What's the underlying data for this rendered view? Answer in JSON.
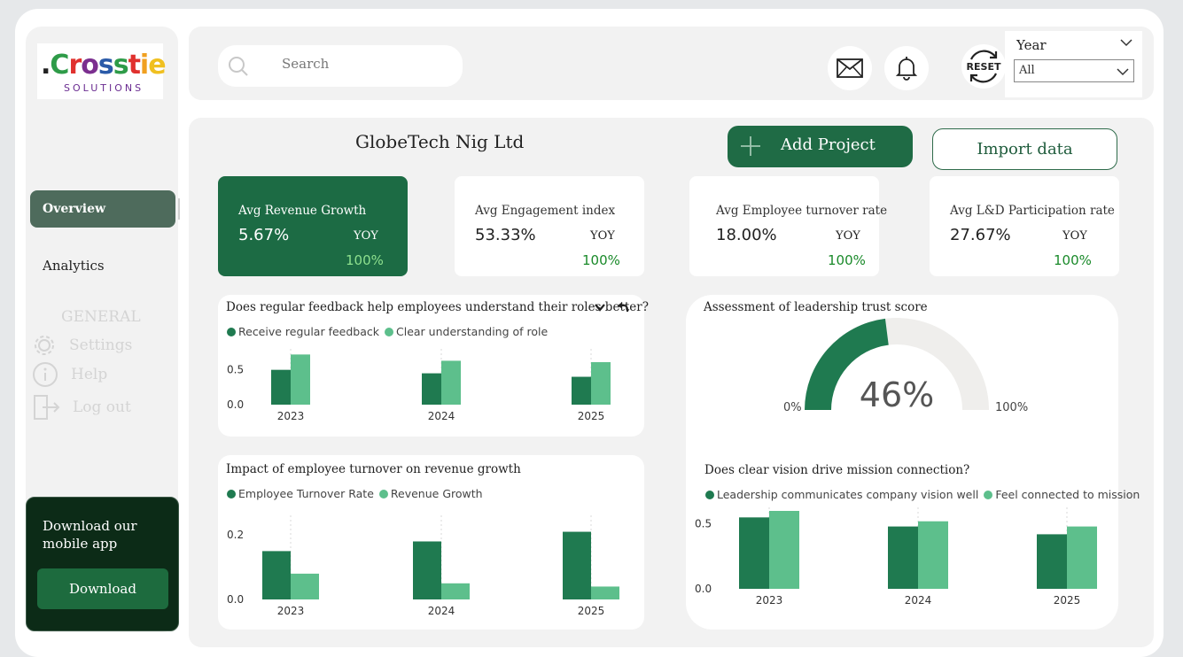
{
  "logo": {
    "brand": ".Crosstie",
    "sub": "SOLUTIONS"
  },
  "sidebar": {
    "overview": "Overview",
    "analytics": "Analytics",
    "general_title": "GENERAL",
    "items": [
      {
        "label": "Settings",
        "icon": "gear-icon"
      },
      {
        "label": "Help",
        "icon": "info-icon"
      },
      {
        "label": "Log out",
        "icon": "logout-icon"
      }
    ],
    "promo_text": "Download our mobile app",
    "promo_button": "Download"
  },
  "topbar": {
    "search_placeholder": "Search",
    "reset_label": "RESET",
    "year_label": "Year",
    "year_value": "All"
  },
  "main": {
    "company": "GlobeTech Nig Ltd",
    "add_project": "Add Project",
    "import_data": "Import data"
  },
  "kpis": [
    {
      "title": "Avg Revenue Growth",
      "value": "5.67%",
      "yoy": "YOY",
      "change": "100%"
    },
    {
      "title": "Avg Engagement index",
      "value": "53.33%",
      "yoy": "YOY",
      "change": "100%"
    },
    {
      "title": "Avg Employee turnover rate",
      "value": "18.00%",
      "yoy": "YOY",
      "change": "100%"
    },
    {
      "title": "Avg L&D Participation rate",
      "value": "27.67%",
      "yoy": "YOY",
      "change": "100%"
    }
  ],
  "colors": {
    "dark_green": "#1f7a50",
    "light_green": "#5dbf8c",
    "accent": "#1c6b44"
  },
  "chart_data": [
    {
      "type": "bar",
      "title": "Does regular feedback help employees understand their roles better?",
      "categories": [
        "2023",
        "2024",
        "2025"
      ],
      "series": [
        {
          "name": "Receive regular feedback",
          "values": [
            0.5,
            0.45,
            0.4
          ]
        },
        {
          "name": "Clear understanding of role",
          "values": [
            0.72,
            0.63,
            0.61
          ]
        }
      ],
      "yticks": [
        "0.0",
        "0.5"
      ],
      "ylim": [
        0,
        0.75
      ]
    },
    {
      "type": "gauge",
      "title": "Assessment of leadership trust score",
      "value": 46,
      "value_label": "46%",
      "min_label": "0%",
      "max_label": "100%"
    },
    {
      "type": "bar",
      "title": "Impact of employee turnover on revenue growth",
      "categories": [
        "2023",
        "2024",
        "2025"
      ],
      "series": [
        {
          "name": "Employee Turnover Rate",
          "values": [
            0.15,
            0.18,
            0.21
          ]
        },
        {
          "name": "Revenue Growth",
          "values": [
            0.08,
            0.05,
            0.04
          ]
        }
      ],
      "yticks": [
        "0.0",
        "0.2"
      ],
      "ylim": [
        0,
        0.25
      ]
    },
    {
      "type": "bar",
      "title": "Does clear vision drive mission connection?",
      "categories": [
        "2023",
        "2024",
        "2025"
      ],
      "series": [
        {
          "name": "Leadership communicates company vision well",
          "values": [
            0.55,
            0.48,
            0.42
          ]
        },
        {
          "name": "Feel connected to mission",
          "values": [
            0.6,
            0.52,
            0.48
          ]
        }
      ],
      "yticks": [
        "0.0",
        "0.5"
      ],
      "ylim": [
        0,
        0.6
      ]
    }
  ]
}
